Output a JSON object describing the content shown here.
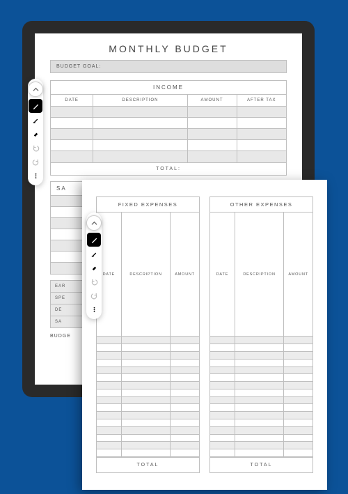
{
  "page1": {
    "title": "MONTHLY BUDGET",
    "goal_label": "BUDGET GOAL:",
    "income": {
      "title": "INCOME",
      "cols": [
        "DATE",
        "DESCRIPTION",
        "AMOUNT",
        "AFTER TAX"
      ],
      "total": "TOTAL:"
    },
    "section2_partial": "SA",
    "summary": {
      "r0": "EAR",
      "r1": "SPE",
      "r2": "DE",
      "r3": "SA"
    },
    "bottom_partial": "BUDGE"
  },
  "page2": {
    "fixed": {
      "title": "FIXED EXPENSES",
      "cols": [
        "DATE",
        "DESCRIPTION",
        "AMOUNT"
      ],
      "total": "TOTAL"
    },
    "other": {
      "title": "OTHER EXPENSES",
      "cols": [
        "DATE",
        "DESCRIPTION",
        "AMOUNT"
      ],
      "total": "TOTAL"
    }
  },
  "toolbar": {
    "collapse": "chevron-up",
    "pen": "pen",
    "marker": "marker",
    "eraser": "eraser",
    "undo": "undo",
    "redo": "redo",
    "more": "more"
  }
}
